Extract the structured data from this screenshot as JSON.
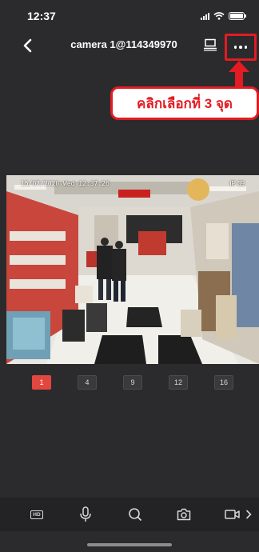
{
  "status_bar": {
    "time": "12:37"
  },
  "nav": {
    "title": "camera 1@114349970"
  },
  "annotation": {
    "callout_text": "คลิกเลือกที่ 3 จุด"
  },
  "video": {
    "osd_time": "15/07/2020 Wed 12:37:26",
    "osd_channel": "IP 39"
  },
  "split_options": [
    {
      "label": "1",
      "active": true
    },
    {
      "label": "4",
      "active": false
    },
    {
      "label": "9",
      "active": false
    },
    {
      "label": "12",
      "active": false
    },
    {
      "label": "16",
      "active": false
    }
  ],
  "toolbar": {
    "hd_label": "HD",
    "icons": [
      "hd-icon",
      "microphone-icon",
      "search-icon",
      "camera-icon",
      "record-icon",
      "chevron-right-icon"
    ]
  },
  "colors": {
    "accent": "#e31b23",
    "active_split": "#e2473f",
    "background": "#2b2b2d"
  }
}
